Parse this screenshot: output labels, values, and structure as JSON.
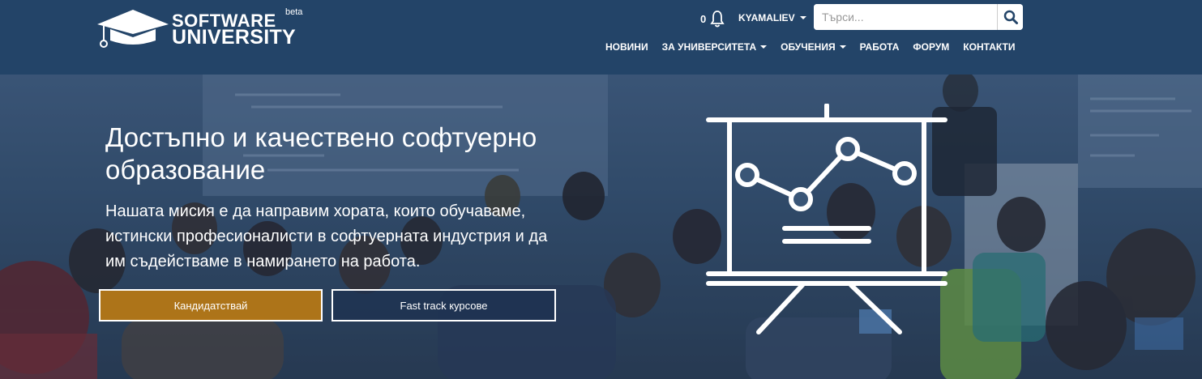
{
  "header": {
    "logo": {
      "line1": "SOFTWARE",
      "line2": "UNIVERSITY",
      "beta": "beta"
    },
    "notifications": {
      "count": "0",
      "icon": "bell-icon"
    },
    "user": {
      "name": "KYAMALIEV"
    },
    "search": {
      "placeholder": "Търси...",
      "value": "",
      "icon": "search-icon"
    },
    "nav": [
      {
        "label": "НОВИНИ",
        "dropdown": false
      },
      {
        "label": "ЗА УНИВЕРСИТЕТА",
        "dropdown": true
      },
      {
        "label": "ОБУЧЕНИЯ",
        "dropdown": true
      },
      {
        "label": "РАБОТА",
        "dropdown": false
      },
      {
        "label": "ФОРУМ",
        "dropdown": false
      },
      {
        "label": "КОНТАКТИ",
        "dropdown": false
      }
    ]
  },
  "hero": {
    "title": "Достъпно и качествено софтуерно образование",
    "text": "Нашата мисия е да направим хората, които обучаваме, истински професионалисти в софтуерната индустрия и да им съдействаме в намирането на работа.",
    "buttons": {
      "apply": "Кандидатствай",
      "fast_track": "Fast track курсове"
    },
    "illustration": "presentation-chart-icon"
  },
  "colors": {
    "header_bg": "#234468",
    "apply_button": "#b87814",
    "fast_track_button": "#1e3250"
  }
}
